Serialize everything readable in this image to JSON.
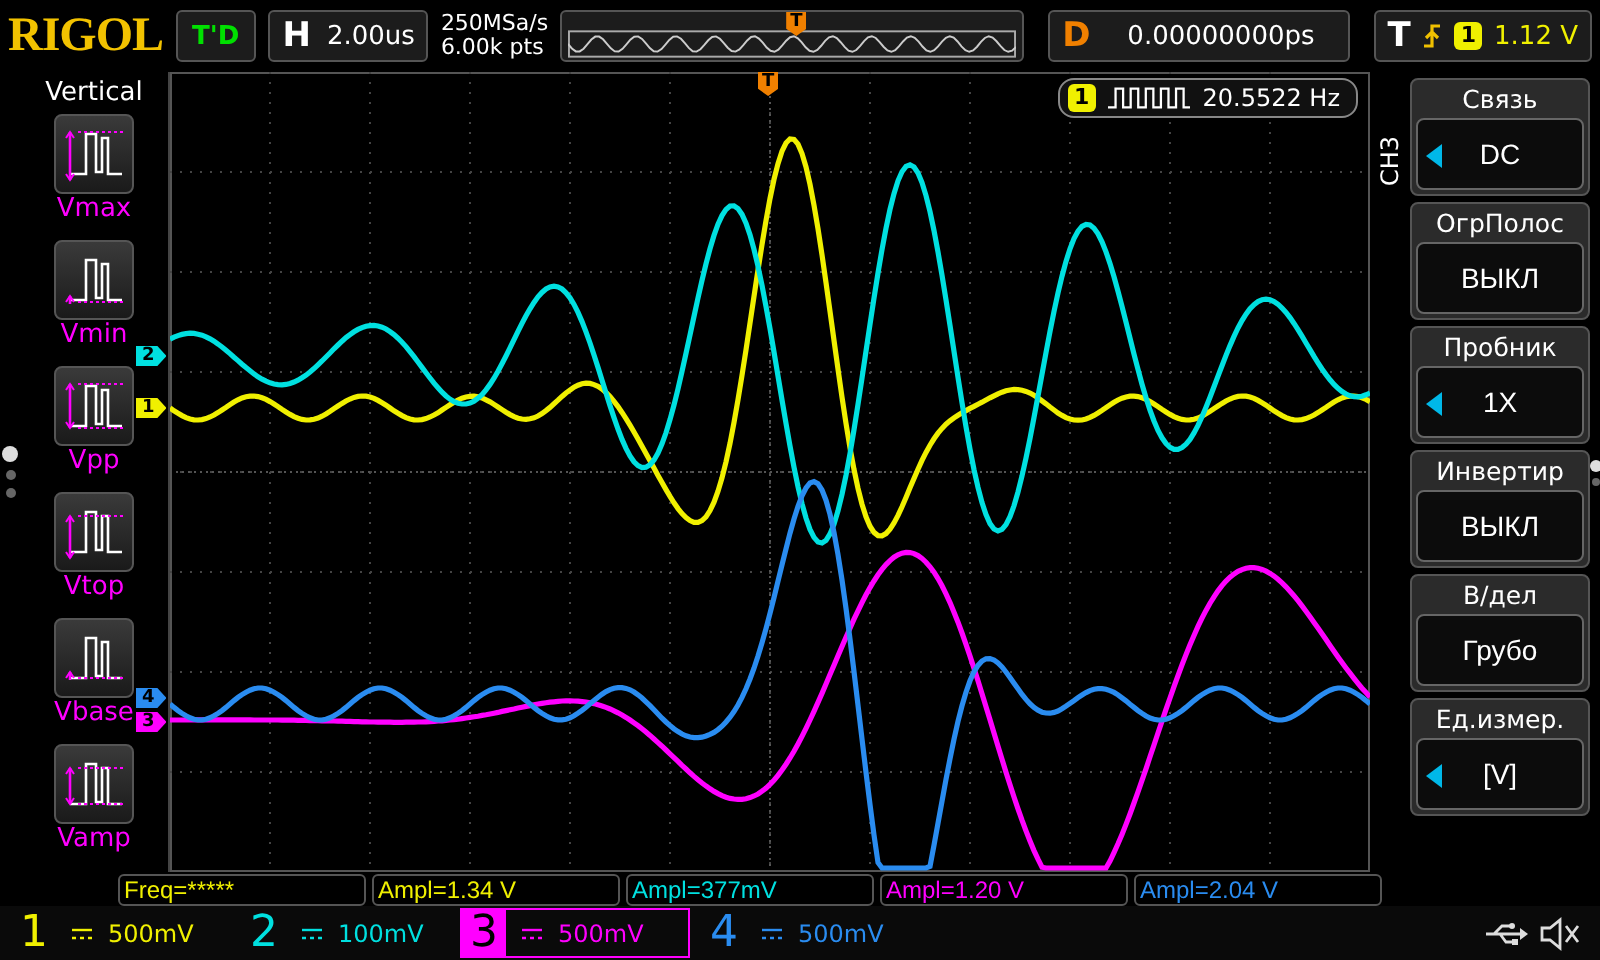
{
  "brand": "RIGOL",
  "trigger_status": "T'D",
  "timebase": {
    "label": "H",
    "value": "2.00us"
  },
  "acquisition": {
    "sample_rate": "250MSa/s",
    "memory_depth": "6.00k pts"
  },
  "overview": {
    "marker": "T"
  },
  "delay": {
    "label": "D",
    "value": "0.00000000ps"
  },
  "trigger": {
    "label": "T",
    "source": "1",
    "level": "1.12 V"
  },
  "left_menu": {
    "title": "Vertical",
    "items": [
      {
        "label": "Vmax",
        "kind": "vmax"
      },
      {
        "label": "Vmin",
        "kind": "vmin"
      },
      {
        "label": "Vpp",
        "kind": "vpp"
      },
      {
        "label": "Vtop",
        "kind": "vtop"
      },
      {
        "label": "Vbase",
        "kind": "vbase"
      },
      {
        "label": "Vamp",
        "kind": "vamp"
      }
    ],
    "pages": [
      {
        "selected": true
      },
      {
        "selected": false
      },
      {
        "selected": false
      }
    ]
  },
  "grid": {
    "trigger_position_marker": "T",
    "channel_markers": [
      {
        "label": "2",
        "color": "#00e0e0"
      },
      {
        "label": "1",
        "color": "#f0f000"
      },
      {
        "label": "4",
        "color": "#2a8cf0"
      },
      {
        "label": "3",
        "color": "#ff00ff"
      }
    ],
    "counter": {
      "source": "1",
      "value": "20.5522 Hz"
    }
  },
  "right_menu": {
    "channel_tab": "CH3",
    "items": [
      {
        "title": "Связь",
        "value": "DC",
        "adjustable": true
      },
      {
        "title": "ОгрПолос",
        "value": "ВЫКЛ",
        "adjustable": false
      },
      {
        "title": "Пробник",
        "value": "1X",
        "adjustable": true
      },
      {
        "title": "Инвертир",
        "value": "ВЫКЛ",
        "adjustable": false
      },
      {
        "title": "В/дел",
        "value": "Грубо",
        "adjustable": false
      },
      {
        "title": "Ед.измер.",
        "value": "[V]",
        "adjustable": true
      }
    ],
    "pages": [
      {
        "selected": true
      },
      {
        "selected": false
      }
    ]
  },
  "measurements": [
    {
      "text": "Freq=*****",
      "color": "#f0f000"
    },
    {
      "text": "Ampl=1.34 V",
      "color": "#f0f000"
    },
    {
      "text": "Ampl=377mV",
      "color": "#00e0e0"
    },
    {
      "text": "Ampl=1.20 V",
      "color": "#ff00ff"
    },
    {
      "text": "Ampl=2.04 V",
      "color": "#2a8cf0"
    }
  ],
  "channels": [
    {
      "number": "1",
      "scale": "500mV",
      "color": "#f0f000",
      "selected": false
    },
    {
      "number": "2",
      "scale": "100mV",
      "color": "#00e0e0",
      "selected": false
    },
    {
      "number": "3",
      "scale": "500mV",
      "color": "#ff00ff",
      "selected": true
    },
    {
      "number": "4",
      "scale": "500mV",
      "color": "#2a8cf0",
      "selected": false
    }
  ]
}
